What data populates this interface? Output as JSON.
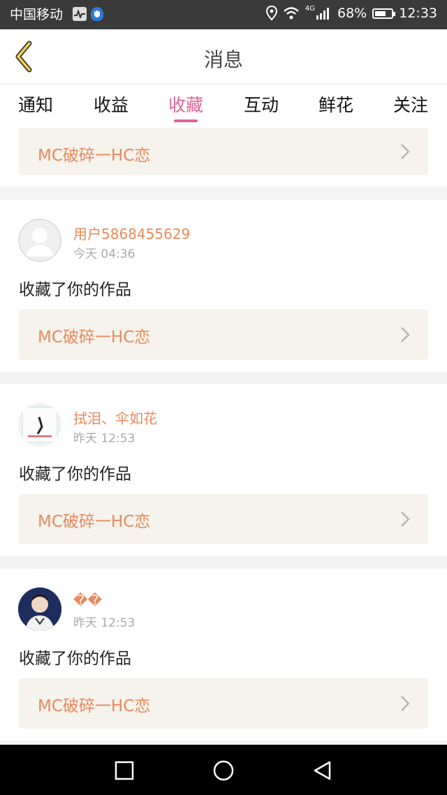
{
  "status_bar": {
    "carrier": "中国移动",
    "network": "4G",
    "battery": "68%",
    "battery_level": 0.68,
    "time": "12:33"
  },
  "header": {
    "title": "消息"
  },
  "tabs": [
    "通知",
    "收益",
    "收藏",
    "互动",
    "鲜花",
    "关注"
  ],
  "active_tab": "收藏",
  "accent_color": "#e0649a",
  "name_color": "#e9895b",
  "top_work": {
    "title": "MC破碎一HC恋"
  },
  "items": [
    {
      "user": "用户5868455629",
      "time": "今天 04:36",
      "action": "收藏了你的作品",
      "work": "MC破碎一HC恋"
    },
    {
      "user": "拭泪、伞如花",
      "time": "昨天 12:53",
      "action": "收藏了你的作品",
      "work": "MC破碎一HC恋"
    },
    {
      "user": "��",
      "time": "昨天 12:53",
      "action": "收藏了你的作品",
      "work": "MC破碎一HC恋"
    }
  ]
}
